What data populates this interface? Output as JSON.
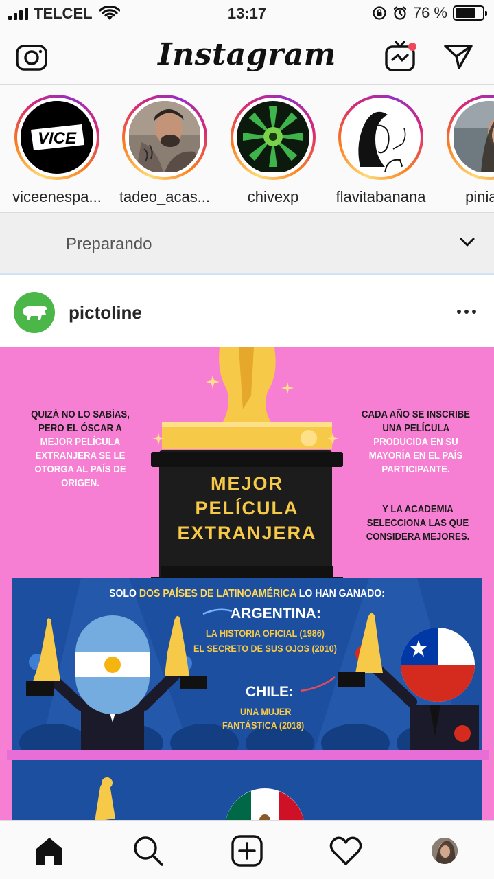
{
  "status_bar": {
    "carrier": "TELCEL",
    "time": "13:17",
    "battery_percent": "76 %",
    "battery_level": 0.76
  },
  "header": {
    "logo": "Instagram",
    "camera_icon": "camera-icon",
    "igtv_icon": "igtv-icon",
    "direct_icon": "paper-plane-icon",
    "notification_dot_color": "#ed4956"
  },
  "stories": [
    {
      "username": "viceenespa..."
    },
    {
      "username": "tadeo_acas..."
    },
    {
      "username": "chivexp"
    },
    {
      "username": "flavitabanana"
    },
    {
      "username": "piniaex"
    }
  ],
  "upload": {
    "status_text": "Preparando"
  },
  "post": {
    "username": "pictoline",
    "avatar_color": "#4cb749",
    "image": {
      "background": "#f77fd3",
      "left_caption": {
        "line1": "QUIZÁ NO LO SABÍAS,",
        "line2": "PERO EL ÓSCAR A",
        "highlight": "MEJOR PELÍCULA EXTRANJERA SE LE OTORGA AL PAÍS DE ORIGEN."
      },
      "right_caption": {
        "line1": "CADA AÑO SE INSCRIBE UNA PELÍCULA",
        "highlight": "PRODUCIDA EN SU MAYORÍA EN EL PAÍS PARTICIPANTE."
      },
      "right_caption2": "Y LA ACADEMIA SELECCIONA LAS QUE CONSIDERA MEJORES.",
      "pedestal_title": {
        "line1": "MEJOR",
        "line2": "PELÍCULA",
        "line3": "EXTRANJERA"
      },
      "panel_heading": {
        "pre": "SOLO",
        "highlight": "DOS PAÍSES DE LATINOAMÉRICA",
        "post": "LO HAN GANADO:"
      },
      "argentina": {
        "title": "ARGENTINA:",
        "film1": "LA HISTORIA OFICIAL (1986)",
        "film2": "EL SECRETO DE SUS OJOS (2010)"
      },
      "chile": {
        "title": "CHILE:",
        "film1": "UNA MUJER",
        "film2": "FANTÁSTICA (2018)"
      }
    }
  },
  "tabbar": {
    "home": "home-icon",
    "search": "search-icon",
    "new_post": "add-post-icon",
    "activity": "heart-icon",
    "profile": "profile-avatar"
  }
}
